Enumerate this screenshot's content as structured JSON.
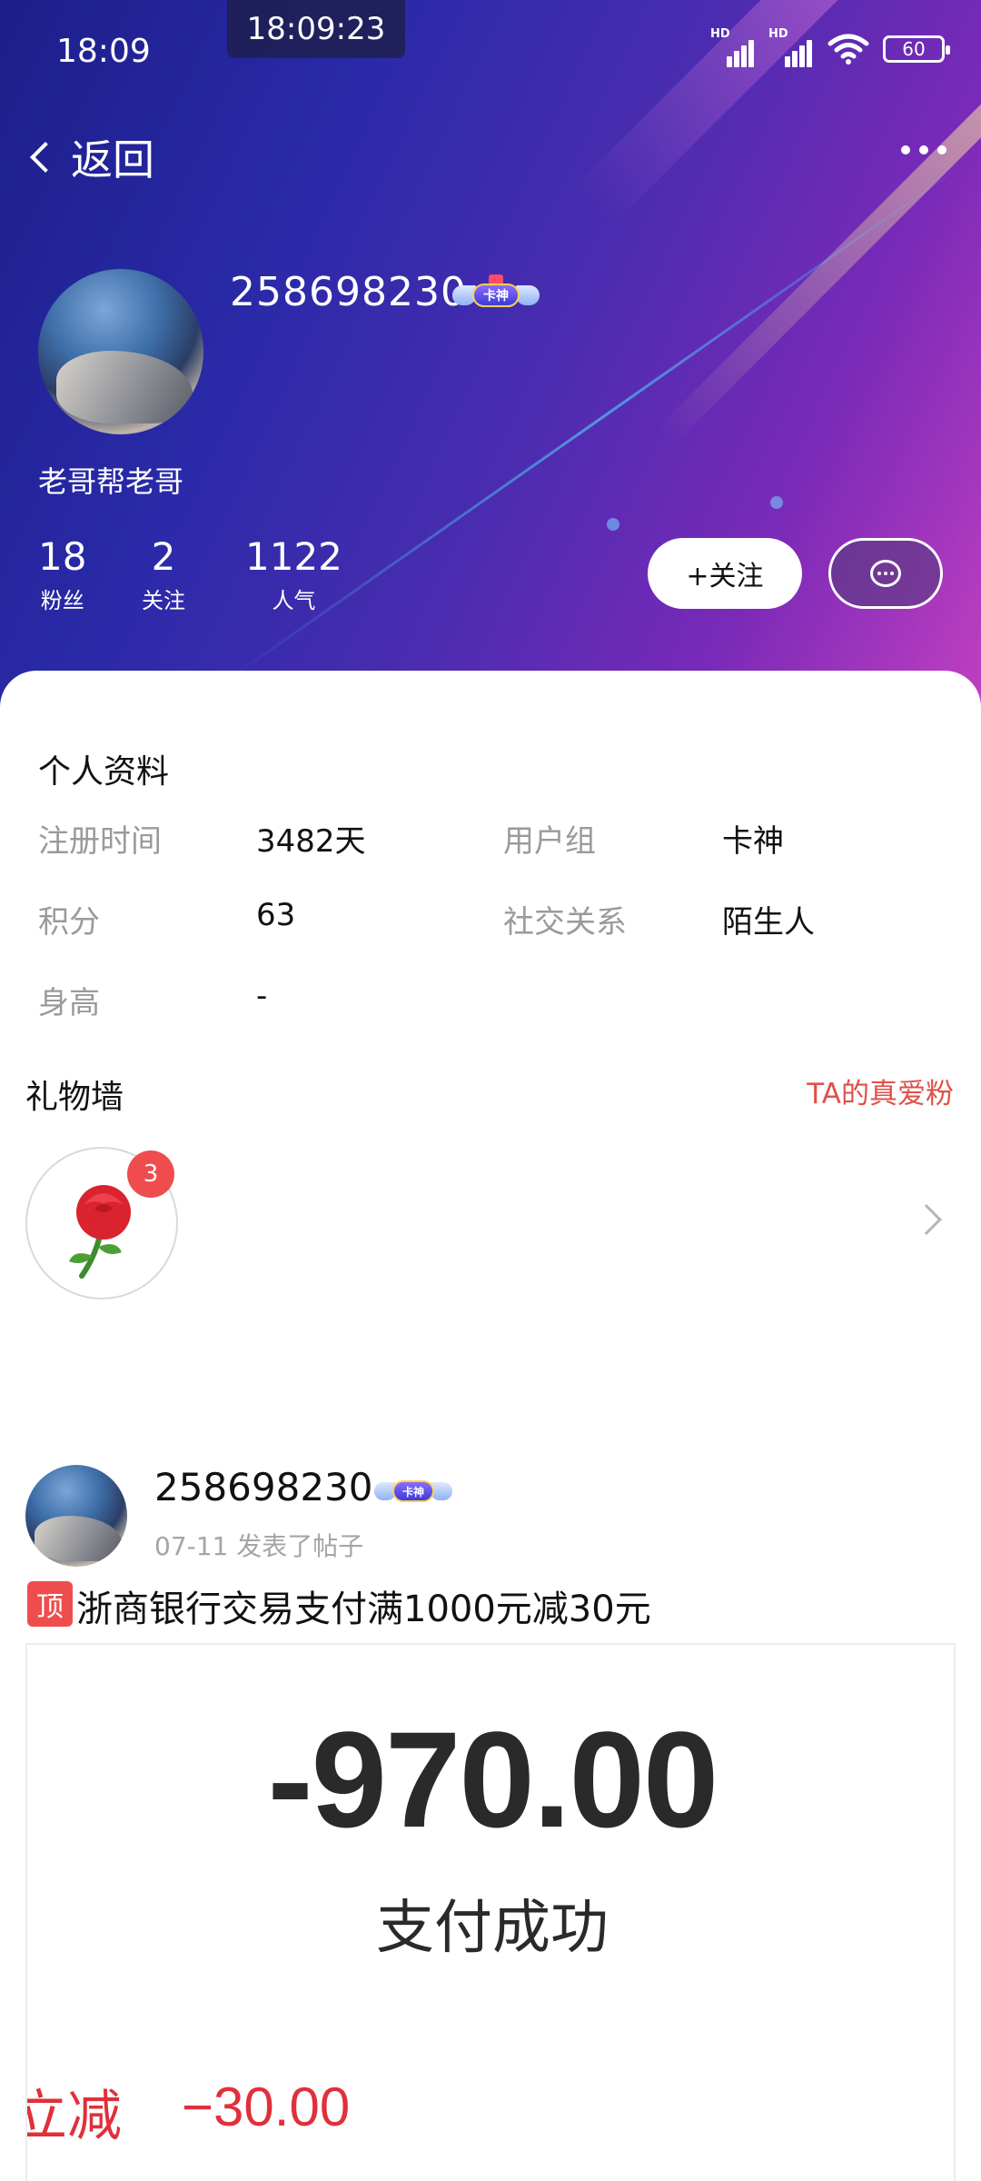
{
  "status_bar": {
    "time": "18:09",
    "clock_overlay": "18:09:23",
    "signal_1_tag": "HD",
    "signal_2_tag": "HD",
    "battery": "60"
  },
  "nav": {
    "back_label": "返回"
  },
  "profile": {
    "user_id": "258698230",
    "badge_text": "卡神",
    "nickname": "老哥帮老哥",
    "stats": [
      {
        "value": "18",
        "label": "粉丝"
      },
      {
        "value": "2",
        "label": "关注"
      },
      {
        "value": "1122",
        "label": "人气"
      }
    ],
    "follow_label": "+关注"
  },
  "personal_info": {
    "title": "个人资料",
    "fields": [
      {
        "label": "注册时间",
        "value": "3482天"
      },
      {
        "label": "用户组",
        "value": "卡神"
      },
      {
        "label": "积分",
        "value": "63"
      },
      {
        "label": "社交关系",
        "value": "陌生人"
      },
      {
        "label": "身高",
        "value": "-"
      }
    ]
  },
  "gift_wall": {
    "title": "礼物墙",
    "link": "TA的真爱粉",
    "gift_icon": "rose-icon",
    "gift_count": "3"
  },
  "post": {
    "author": "258698230",
    "badge_text": "卡神",
    "meta": "07-11 发表了帖子",
    "pin_tag": "顶",
    "title": "浙商银行交易支付满1000元减30元",
    "image": {
      "amount": "-970.00",
      "status": "支付成功",
      "discount_label": "立减",
      "discount_value": "−30.00"
    }
  },
  "colors": {
    "accent_red": "#ef4d4d",
    "link_red": "#e0504a",
    "hero_start": "#1c1f8a",
    "hero_end": "#c03fc0"
  }
}
